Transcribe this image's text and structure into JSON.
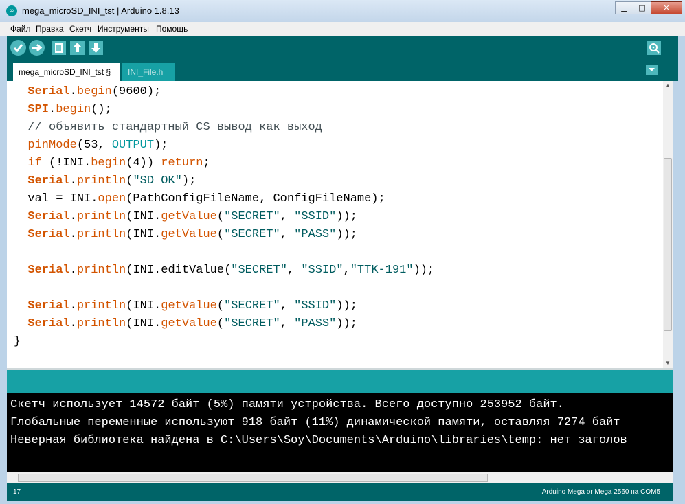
{
  "window": {
    "title": "mega_microSD_INI_tst | Arduino 1.8.13",
    "app_icon": "∞",
    "controls": {
      "minimize": "▁",
      "maximize": "□",
      "close": "✕"
    }
  },
  "menu": [
    "Файл",
    "Правка",
    "Скетч",
    "Инструменты",
    "Помощь"
  ],
  "toolbar": {
    "buttons": [
      "verify-icon",
      "upload-icon",
      "new-icon",
      "open-icon",
      "save-icon"
    ],
    "serial_monitor": "serial-monitor-icon"
  },
  "tabs": [
    {
      "label": "mega_microSD_INI_tst §",
      "active": true
    },
    {
      "label": "INI_File.h",
      "active": false
    }
  ],
  "code": {
    "lines": [
      [
        {
          "t": "  "
        },
        {
          "t": "Serial",
          "c": "kw"
        },
        {
          "t": "."
        },
        {
          "t": "begin",
          "c": "fn"
        },
        {
          "t": "(9600);"
        }
      ],
      [
        {
          "t": "  "
        },
        {
          "t": "SPI",
          "c": "kw"
        },
        {
          "t": "."
        },
        {
          "t": "begin",
          "c": "fn"
        },
        {
          "t": "();"
        }
      ],
      [
        {
          "t": "  // объявить стандартный CS вывод как выход",
          "c": "cm"
        }
      ],
      [
        {
          "t": "  "
        },
        {
          "t": "pinMode",
          "c": "fn"
        },
        {
          "t": "(53, "
        },
        {
          "t": "OUTPUT",
          "c": "cn"
        },
        {
          "t": ");"
        }
      ],
      [
        {
          "t": "  "
        },
        {
          "t": "if",
          "c": "fn"
        },
        {
          "t": " (!INI."
        },
        {
          "t": "begin",
          "c": "fn"
        },
        {
          "t": "(4)) "
        },
        {
          "t": "return",
          "c": "fn"
        },
        {
          "t": ";"
        }
      ],
      [
        {
          "t": "  "
        },
        {
          "t": "Serial",
          "c": "kw"
        },
        {
          "t": "."
        },
        {
          "t": "println",
          "c": "fn"
        },
        {
          "t": "("
        },
        {
          "t": "\"SD OK\"",
          "c": "st"
        },
        {
          "t": ");"
        }
      ],
      [
        {
          "t": "  val = INI."
        },
        {
          "t": "open",
          "c": "fn"
        },
        {
          "t": "(PathConfigFileName, ConfigFileName);"
        }
      ],
      [
        {
          "t": "  "
        },
        {
          "t": "Serial",
          "c": "kw"
        },
        {
          "t": "."
        },
        {
          "t": "println",
          "c": "fn"
        },
        {
          "t": "(INI."
        },
        {
          "t": "getValue",
          "c": "fn"
        },
        {
          "t": "("
        },
        {
          "t": "\"SECRET\"",
          "c": "st"
        },
        {
          "t": ", "
        },
        {
          "t": "\"SSID\"",
          "c": "st"
        },
        {
          "t": "));"
        }
      ],
      [
        {
          "t": "  "
        },
        {
          "t": "Serial",
          "c": "kw"
        },
        {
          "t": "."
        },
        {
          "t": "println",
          "c": "fn"
        },
        {
          "t": "(INI."
        },
        {
          "t": "getValue",
          "c": "fn"
        },
        {
          "t": "("
        },
        {
          "t": "\"SECRET\"",
          "c": "st"
        },
        {
          "t": ", "
        },
        {
          "t": "\"PASS\"",
          "c": "st"
        },
        {
          "t": "));"
        }
      ],
      [
        {
          "t": ""
        }
      ],
      [
        {
          "t": "  "
        },
        {
          "t": "Serial",
          "c": "kw"
        },
        {
          "t": "."
        },
        {
          "t": "println",
          "c": "fn"
        },
        {
          "t": "(INI.editValue("
        },
        {
          "t": "\"SECRET\"",
          "c": "st"
        },
        {
          "t": ", "
        },
        {
          "t": "\"SSID\"",
          "c": "st"
        },
        {
          "t": ","
        },
        {
          "t": "\"TTK-191\"",
          "c": "st"
        },
        {
          "t": "));"
        }
      ],
      [
        {
          "t": ""
        }
      ],
      [
        {
          "t": "  "
        },
        {
          "t": "Serial",
          "c": "kw"
        },
        {
          "t": "."
        },
        {
          "t": "println",
          "c": "fn"
        },
        {
          "t": "(INI."
        },
        {
          "t": "getValue",
          "c": "fn"
        },
        {
          "t": "("
        },
        {
          "t": "\"SECRET\"",
          "c": "st"
        },
        {
          "t": ", "
        },
        {
          "t": "\"SSID\"",
          "c": "st"
        },
        {
          "t": "));"
        }
      ],
      [
        {
          "t": "  "
        },
        {
          "t": "Serial",
          "c": "kw"
        },
        {
          "t": "."
        },
        {
          "t": "println",
          "c": "fn"
        },
        {
          "t": "(INI."
        },
        {
          "t": "getValue",
          "c": "fn"
        },
        {
          "t": "("
        },
        {
          "t": "\"SECRET\"",
          "c": "st"
        },
        {
          "t": ", "
        },
        {
          "t": "\"PASS\"",
          "c": "st"
        },
        {
          "t": "));"
        }
      ],
      [
        {
          "t": "}"
        }
      ]
    ]
  },
  "console": [
    "Скетч использует 14572 байт (5%) памяти устройства. Всего доступно 253952 байт.",
    "Глобальные переменные используют 918 байт (11%) динамической памяти, оставляя 7274 байт",
    "Неверная библиотека найдена в C:\\Users\\Soy\\Documents\\Arduino\\libraries\\temp: нет заголов"
  ],
  "footer": {
    "line_number": "17",
    "board": "Arduino Mega or Mega 2560 на COM5"
  },
  "colors": {
    "teal_dark": "#006468",
    "teal": "#17a1a5",
    "keyword": "#d35400",
    "constant": "#00979c",
    "string": "#005c5f"
  }
}
